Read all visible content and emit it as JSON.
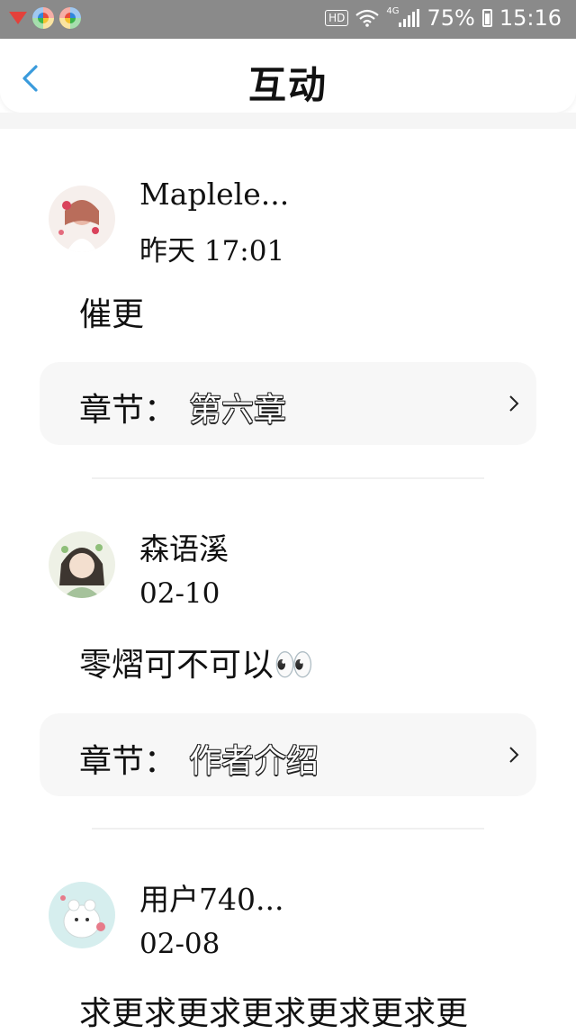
{
  "status_bar": {
    "hd": "HD",
    "network": "4G",
    "battery": "75%",
    "time": "15:16"
  },
  "header": {
    "title": "互动"
  },
  "comments": [
    {
      "username": "Maplele...",
      "date": "昨天 17:01",
      "text": "催更",
      "chapter_prefix": "章节：",
      "chapter_name": "第六章"
    },
    {
      "username": "森语溪",
      "date": "02-10",
      "text": "零熠可不可以👀",
      "chapter_prefix": "章节：",
      "chapter_name": "作者介绍"
    },
    {
      "username": "用户740...",
      "date": "02-08",
      "text": "求更求更求更求更求更求更"
    }
  ],
  "colors": {
    "accent": "#3a9bdc",
    "status_bar_bg": "#8a8a8a",
    "chapter_bg": "#f7f7f7"
  }
}
